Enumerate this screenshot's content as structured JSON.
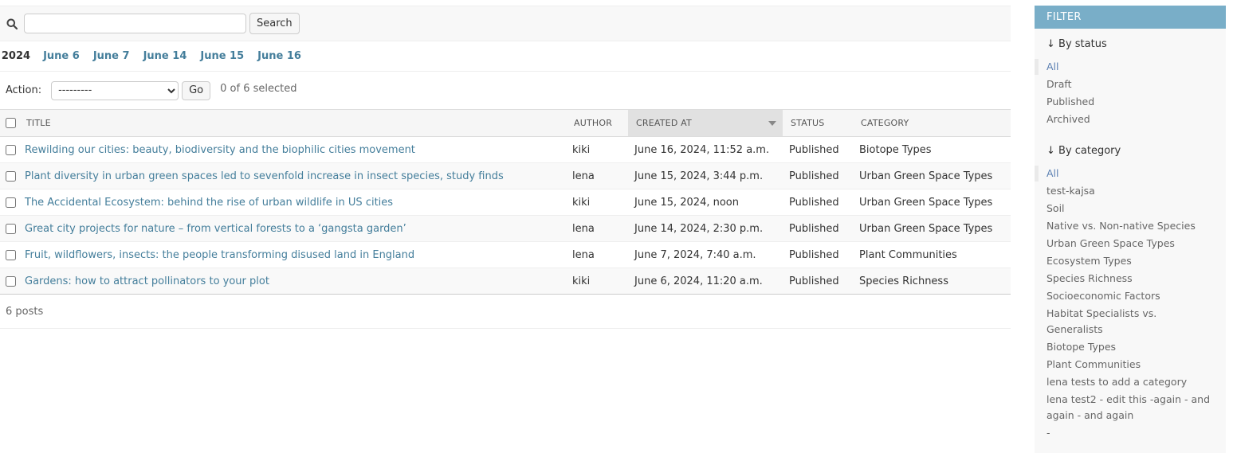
{
  "search": {
    "value": "",
    "placeholder": "",
    "button_label": "Search"
  },
  "date_hierarchy": {
    "back_label": "‹ 2024",
    "days": [
      "June 6",
      "June 7",
      "June 14",
      "June 15",
      "June 16"
    ]
  },
  "actions": {
    "label": "Action:",
    "selected_option": "---------",
    "go_label": "Go",
    "counter": "0 of 6 selected"
  },
  "table": {
    "columns": [
      "TITLE",
      "AUTHOR",
      "CREATED AT",
      "STATUS",
      "CATEGORY"
    ],
    "sorted_column": "CREATED AT",
    "rows": [
      {
        "title": "Rewilding our cities: beauty, biodiversity and the biophilic cities movement",
        "author": "kiki",
        "created_at": "June 16, 2024, 11:52 a.m.",
        "status": "Published",
        "category": "Biotope Types"
      },
      {
        "title": "Plant diversity in urban green spaces led to sevenfold increase in insect species, study finds",
        "author": "lena",
        "created_at": "June 15, 2024, 3:44 p.m.",
        "status": "Published",
        "category": "Urban Green Space Types"
      },
      {
        "title": "The Accidental Ecosystem: behind the rise of urban wildlife in US cities",
        "author": "kiki",
        "created_at": "June 15, 2024, noon",
        "status": "Published",
        "category": "Urban Green Space Types"
      },
      {
        "title": "Great city projects for nature – from vertical forests to a ‘gangsta garden’",
        "author": "lena",
        "created_at": "June 14, 2024, 2:30 p.m.",
        "status": "Published",
        "category": "Urban Green Space Types"
      },
      {
        "title": "Fruit, wildflowers, insects: the people transforming disused land in England",
        "author": "lena",
        "created_at": "June 7, 2024, 7:40 a.m.",
        "status": "Published",
        "category": "Plant Communities"
      },
      {
        "title": "Gardens: how to attract pollinators to your plot",
        "author": "kiki",
        "created_at": "June 6, 2024, 11:20 a.m.",
        "status": "Published",
        "category": "Species Richness"
      }
    ]
  },
  "paginator": {
    "text": "6 posts"
  },
  "filter": {
    "header": "FILTER",
    "sections": [
      {
        "title": "↓ By status",
        "items": [
          "All",
          "Draft",
          "Published",
          "Archived"
        ],
        "selected": "All"
      },
      {
        "title": "↓ By category",
        "items": [
          "All",
          "test-kajsa",
          "Soil",
          "Native vs. Non-native Species",
          "Urban Green Space Types",
          "Ecosystem Types",
          "Species Richness",
          "Socioeconomic Factors",
          "Habitat Specialists vs. Generalists",
          "Biotope Types",
          "Plant Communities",
          "lena tests to add a category",
          "lena test2 - edit this -again - and again - and again",
          "-"
        ],
        "selected": "All"
      }
    ]
  },
  "colors": {
    "link": "#447e9b",
    "filter_header": "#79aec8",
    "selected_filter": "#5b80b2"
  },
  "icons": {
    "search": "search-icon",
    "sort": "sort-descending-icon"
  }
}
